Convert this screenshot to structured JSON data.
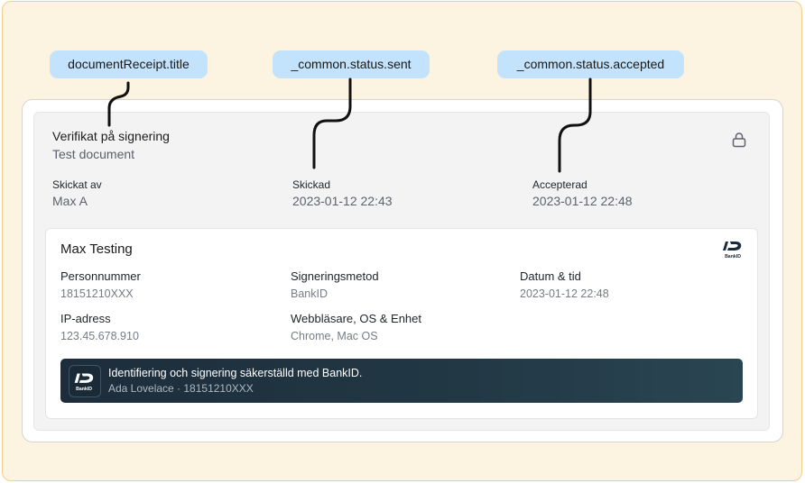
{
  "annotations": {
    "title_key": "documentReceipt.title",
    "sent_key": "_common.status.sent",
    "accepted_key": "_common.status.accepted"
  },
  "receipt": {
    "title": "Verifikat på signering",
    "document_name": "Test document",
    "sent_by_label": "Skickat av",
    "sent_by_value": "Max A",
    "sent_label": "Skickad",
    "sent_value": "2023-01-12 22:43",
    "accepted_label": "Accepterad",
    "accepted_value": "2023-01-12 22:48",
    "lock_icon": "lock-icon"
  },
  "signer": {
    "name": "Max Testing",
    "logo_icon": "bankid-logo-icon",
    "logo_text": "BankID",
    "fields": {
      "personal_number_label": "Personnummer",
      "personal_number_value": "18151210XXX",
      "method_label": "Signeringsmetod",
      "method_value": "BankID",
      "datetime_label": "Datum & tid",
      "datetime_value": "2023-01-12 22:48",
      "ip_label": "IP-adress",
      "ip_value": "123.45.678.910",
      "browser_label": "Webbläsare, OS & Enhet",
      "browser_value": "Chrome, Mac OS"
    },
    "banner": {
      "title": "Identifiering och signering säkerställd med BankID.",
      "subtitle": "Ada Lovelace · 18151210XXX"
    }
  },
  "colors": {
    "frame_bg": "#fdf3e1",
    "pill_bg": "#c3e2fb",
    "banner_bg": "#1d2d3b"
  }
}
